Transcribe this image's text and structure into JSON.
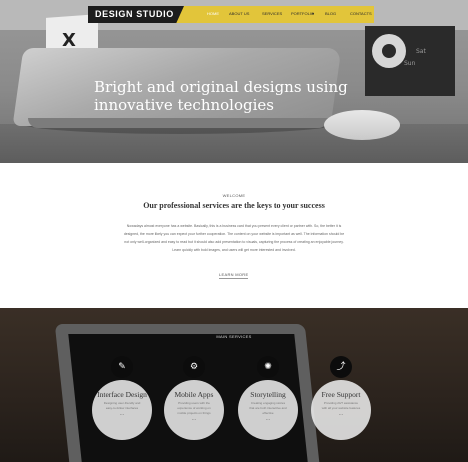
{
  "header": {
    "brand": "DESIGN STUDIO",
    "nav": [
      "HOME",
      "ABOUT US",
      "SERVICES",
      "PORTFOLIO",
      "BLOG",
      "CONTACTS"
    ]
  },
  "hero": {
    "title": "Bright and original designs using innovative technologies",
    "slide_count": 3,
    "active_slide": 1,
    "props": {
      "box_letters": "X",
      "box_small": "X",
      "clock_labels": [
        "Sat",
        "Sun"
      ]
    }
  },
  "welcome": {
    "eyebrow": "WELCOME",
    "title": "Our professional services are the keys to your success",
    "body": "Nowadays almost everyone has a website. Basically, this is a business card that you present every client or partner with. So, the better it is designed, the more likely you can expect your further cooperation. The content on your website is important as well. The information should be not only well-organized and easy to read but it should also add presentation to visuals, capturing the process of creating an enjoyable journey. Learn quickly with bold images, and users will get more interested and involved.",
    "link": "LEARN MORE"
  },
  "services": {
    "eyebrow": "MAIN SERVICES",
    "items": [
      {
        "name": "Interface Design",
        "desc": "Designing user-friendly and easy-to-follow interfaces",
        "more": "...",
        "icon": "brush-icon",
        "glyph": "✎"
      },
      {
        "name": "Mobile Apps",
        "desc": "Providing users with the experience of working on mobile projects on things",
        "more": "...",
        "icon": "gears-icon",
        "glyph": "⚙"
      },
      {
        "name": "Storytelling",
        "desc": "Creating engaging stories that are both interactive and effective",
        "more": "...",
        "icon": "lightbulb-icon",
        "glyph": "✺"
      },
      {
        "name": "Free Support",
        "desc": "Providing 24/7 assistance with all your website features",
        "more": "...",
        "icon": "chart-icon",
        "glyph": "⤴"
      }
    ]
  },
  "colors": {
    "accent": "#e2c53a",
    "dark": "#1d1d1d",
    "hero_text": "#ffffff"
  }
}
